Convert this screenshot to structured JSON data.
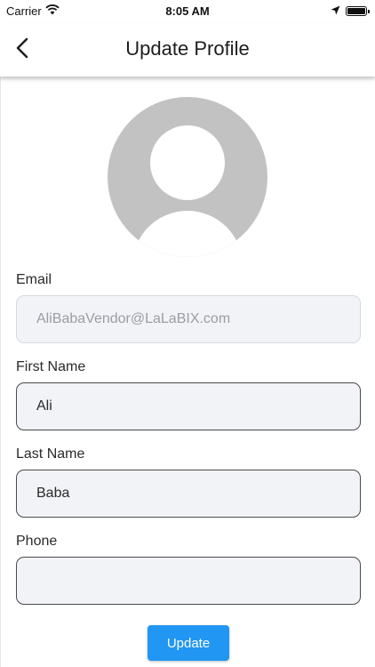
{
  "status_bar": {
    "carrier": "Carrier",
    "time": "8:05 AM",
    "icons": [
      "wifi-icon",
      "location-arrow-icon",
      "battery-icon"
    ]
  },
  "nav": {
    "back_icon": "chevron-left-icon",
    "title": "Update Profile"
  },
  "avatar": {
    "icon": "default-user-avatar-icon"
  },
  "form": {
    "email": {
      "label": "Email",
      "value": "AliBabaVendor@LaLaBIX.com",
      "editable": false
    },
    "first_name": {
      "label": "First Name",
      "value": "Ali"
    },
    "last_name": {
      "label": "Last Name",
      "value": "Baba"
    },
    "phone": {
      "label": "Phone",
      "value": ""
    }
  },
  "update_button": {
    "label": "Update"
  },
  "colors": {
    "accent": "#2196f3",
    "field_background": "#f1f3f7",
    "avatar_gray": "#c2c2c2"
  }
}
